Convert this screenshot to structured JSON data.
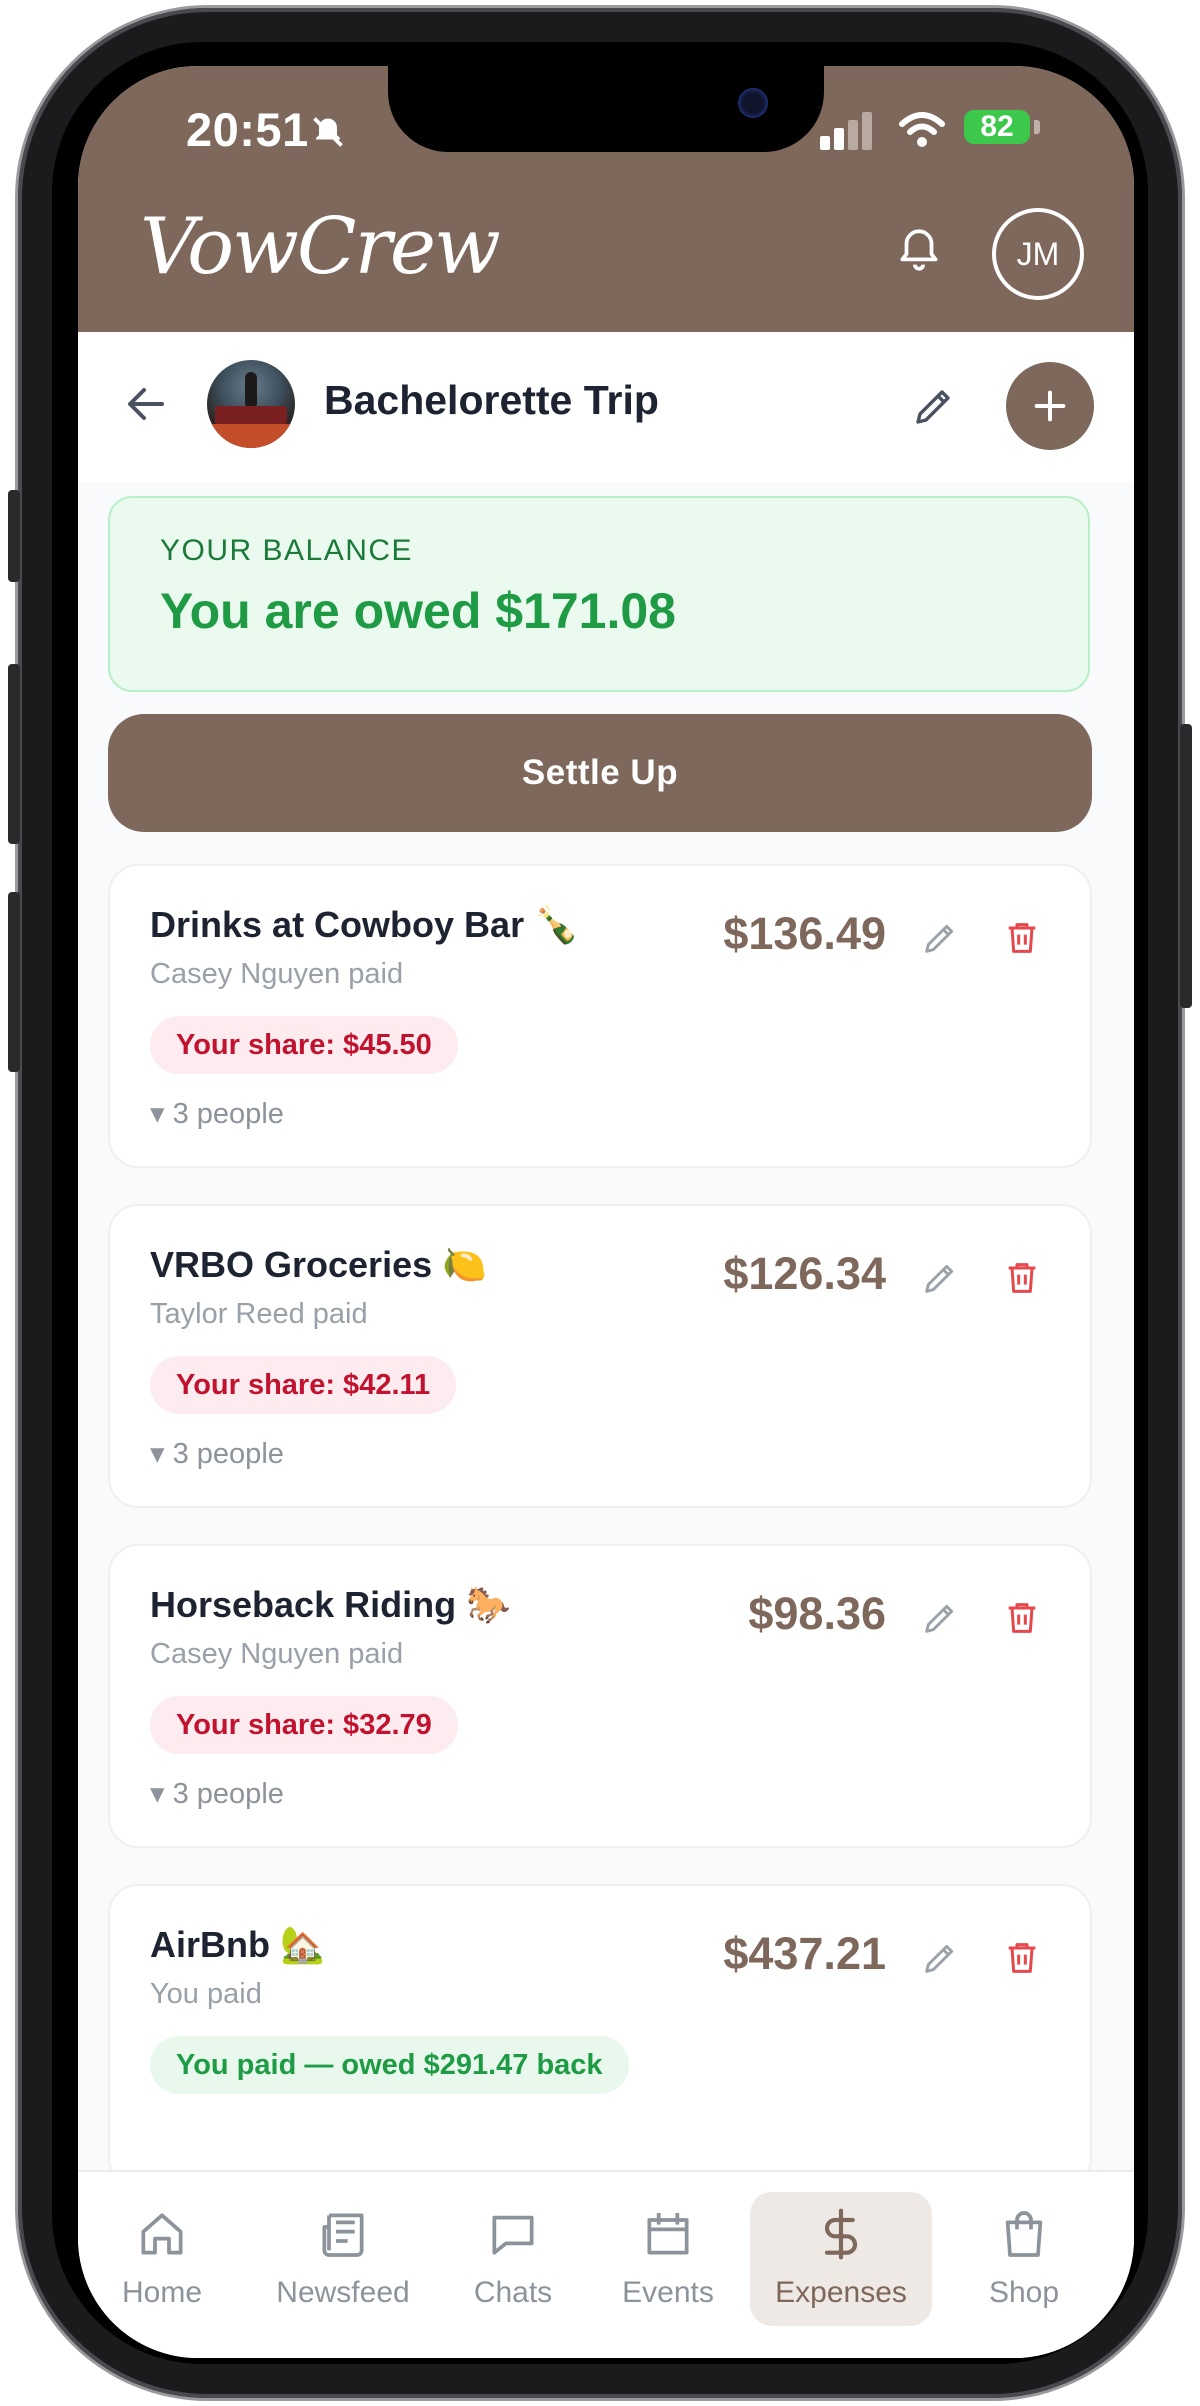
{
  "status_bar": {
    "time": "20:51",
    "battery": "82"
  },
  "header": {
    "logo": "VowCrew",
    "avatar_initials": "JM"
  },
  "app_bar": {
    "title": "Bachelorette Trip"
  },
  "balance": {
    "label": "YOUR BALANCE",
    "value": "You are owed $171.08"
  },
  "settle_button": "Settle Up",
  "expenses": [
    {
      "title": "Drinks at Cowboy Bar 🍾",
      "payer": "Casey Nguyen paid",
      "amount": "$136.49",
      "share": "Your share: $45.50",
      "people": "▾ 3 people"
    },
    {
      "title": "VRBO Groceries 🍋",
      "payer": "Taylor Reed paid",
      "amount": "$126.34",
      "share": "Your share: $42.11",
      "people": "▾ 3 people"
    },
    {
      "title": "Horseback Riding 🐎",
      "payer": "Casey Nguyen paid",
      "amount": "$98.36",
      "share": "Your share: $32.79",
      "people": "▾ 3 people"
    },
    {
      "title": "AirBnb 🏡",
      "payer": "You paid",
      "amount": "$437.21",
      "share": "You paid — owed $291.47 back",
      "people": ""
    }
  ],
  "nav": [
    {
      "label": "Home",
      "icon": "home-icon"
    },
    {
      "label": "Newsfeed",
      "icon": "newspaper-icon"
    },
    {
      "label": "Chats",
      "icon": "chat-icon"
    },
    {
      "label": "Events",
      "icon": "calendar-icon"
    },
    {
      "label": "Expenses",
      "icon": "dollar-icon",
      "active": true
    },
    {
      "label": "Shop",
      "icon": "shopping-bag-icon"
    }
  ],
  "colors": {
    "brand": "#7e675b",
    "positive": "#1e9b44",
    "negative": "#c1122f"
  }
}
